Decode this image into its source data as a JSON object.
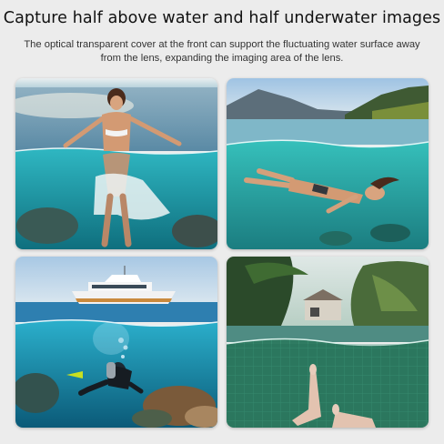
{
  "header": {
    "title": "Capture half above water and half underwater images",
    "subtitle": "The optical transparent cover at the front can support the fluctuating water surface away from the lens, expanding the imaging area of the lens."
  },
  "panels": [
    {
      "scene": "woman-wading-in-sea",
      "water_color": "#2aa3b0"
    },
    {
      "scene": "woman-swimming-near-hills",
      "water_color": "#2ab3b0"
    },
    {
      "scene": "scuba-diver-below-yacht",
      "water_color": "#1f95b5"
    },
    {
      "scene": "pool-legs-with-palms",
      "water_color": "#2c8a6a"
    }
  ]
}
